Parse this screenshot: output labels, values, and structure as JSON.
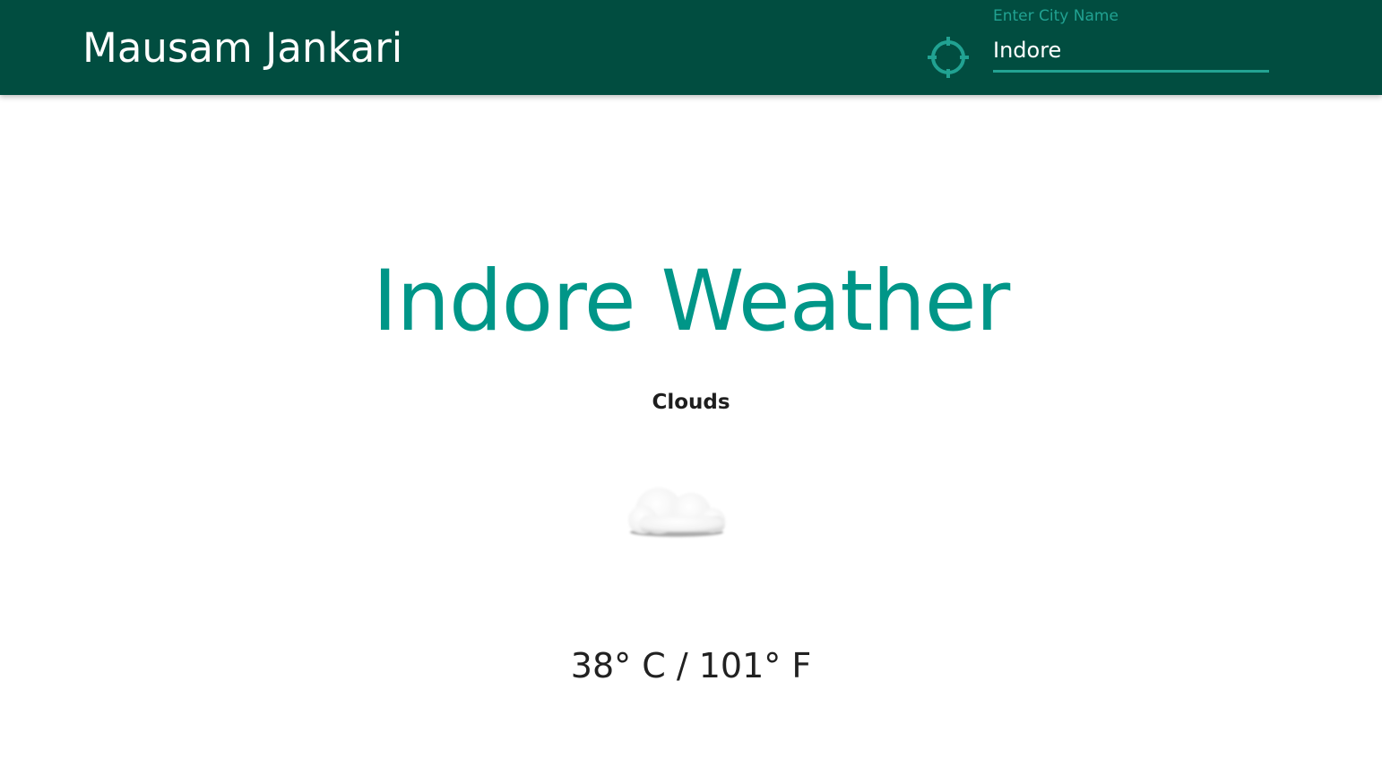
{
  "app": {
    "title": "Mausam Jankari",
    "accent_color": "#009688",
    "header_color": "#014d40"
  },
  "search": {
    "label": "Enter City Name",
    "value": "Indore",
    "locate_icon": "crosshair-location-icon"
  },
  "weather": {
    "title": "Indore Weather",
    "condition": "Clouds",
    "condition_icon": "cloud-icon",
    "temperature": "38° C / 101° F"
  }
}
